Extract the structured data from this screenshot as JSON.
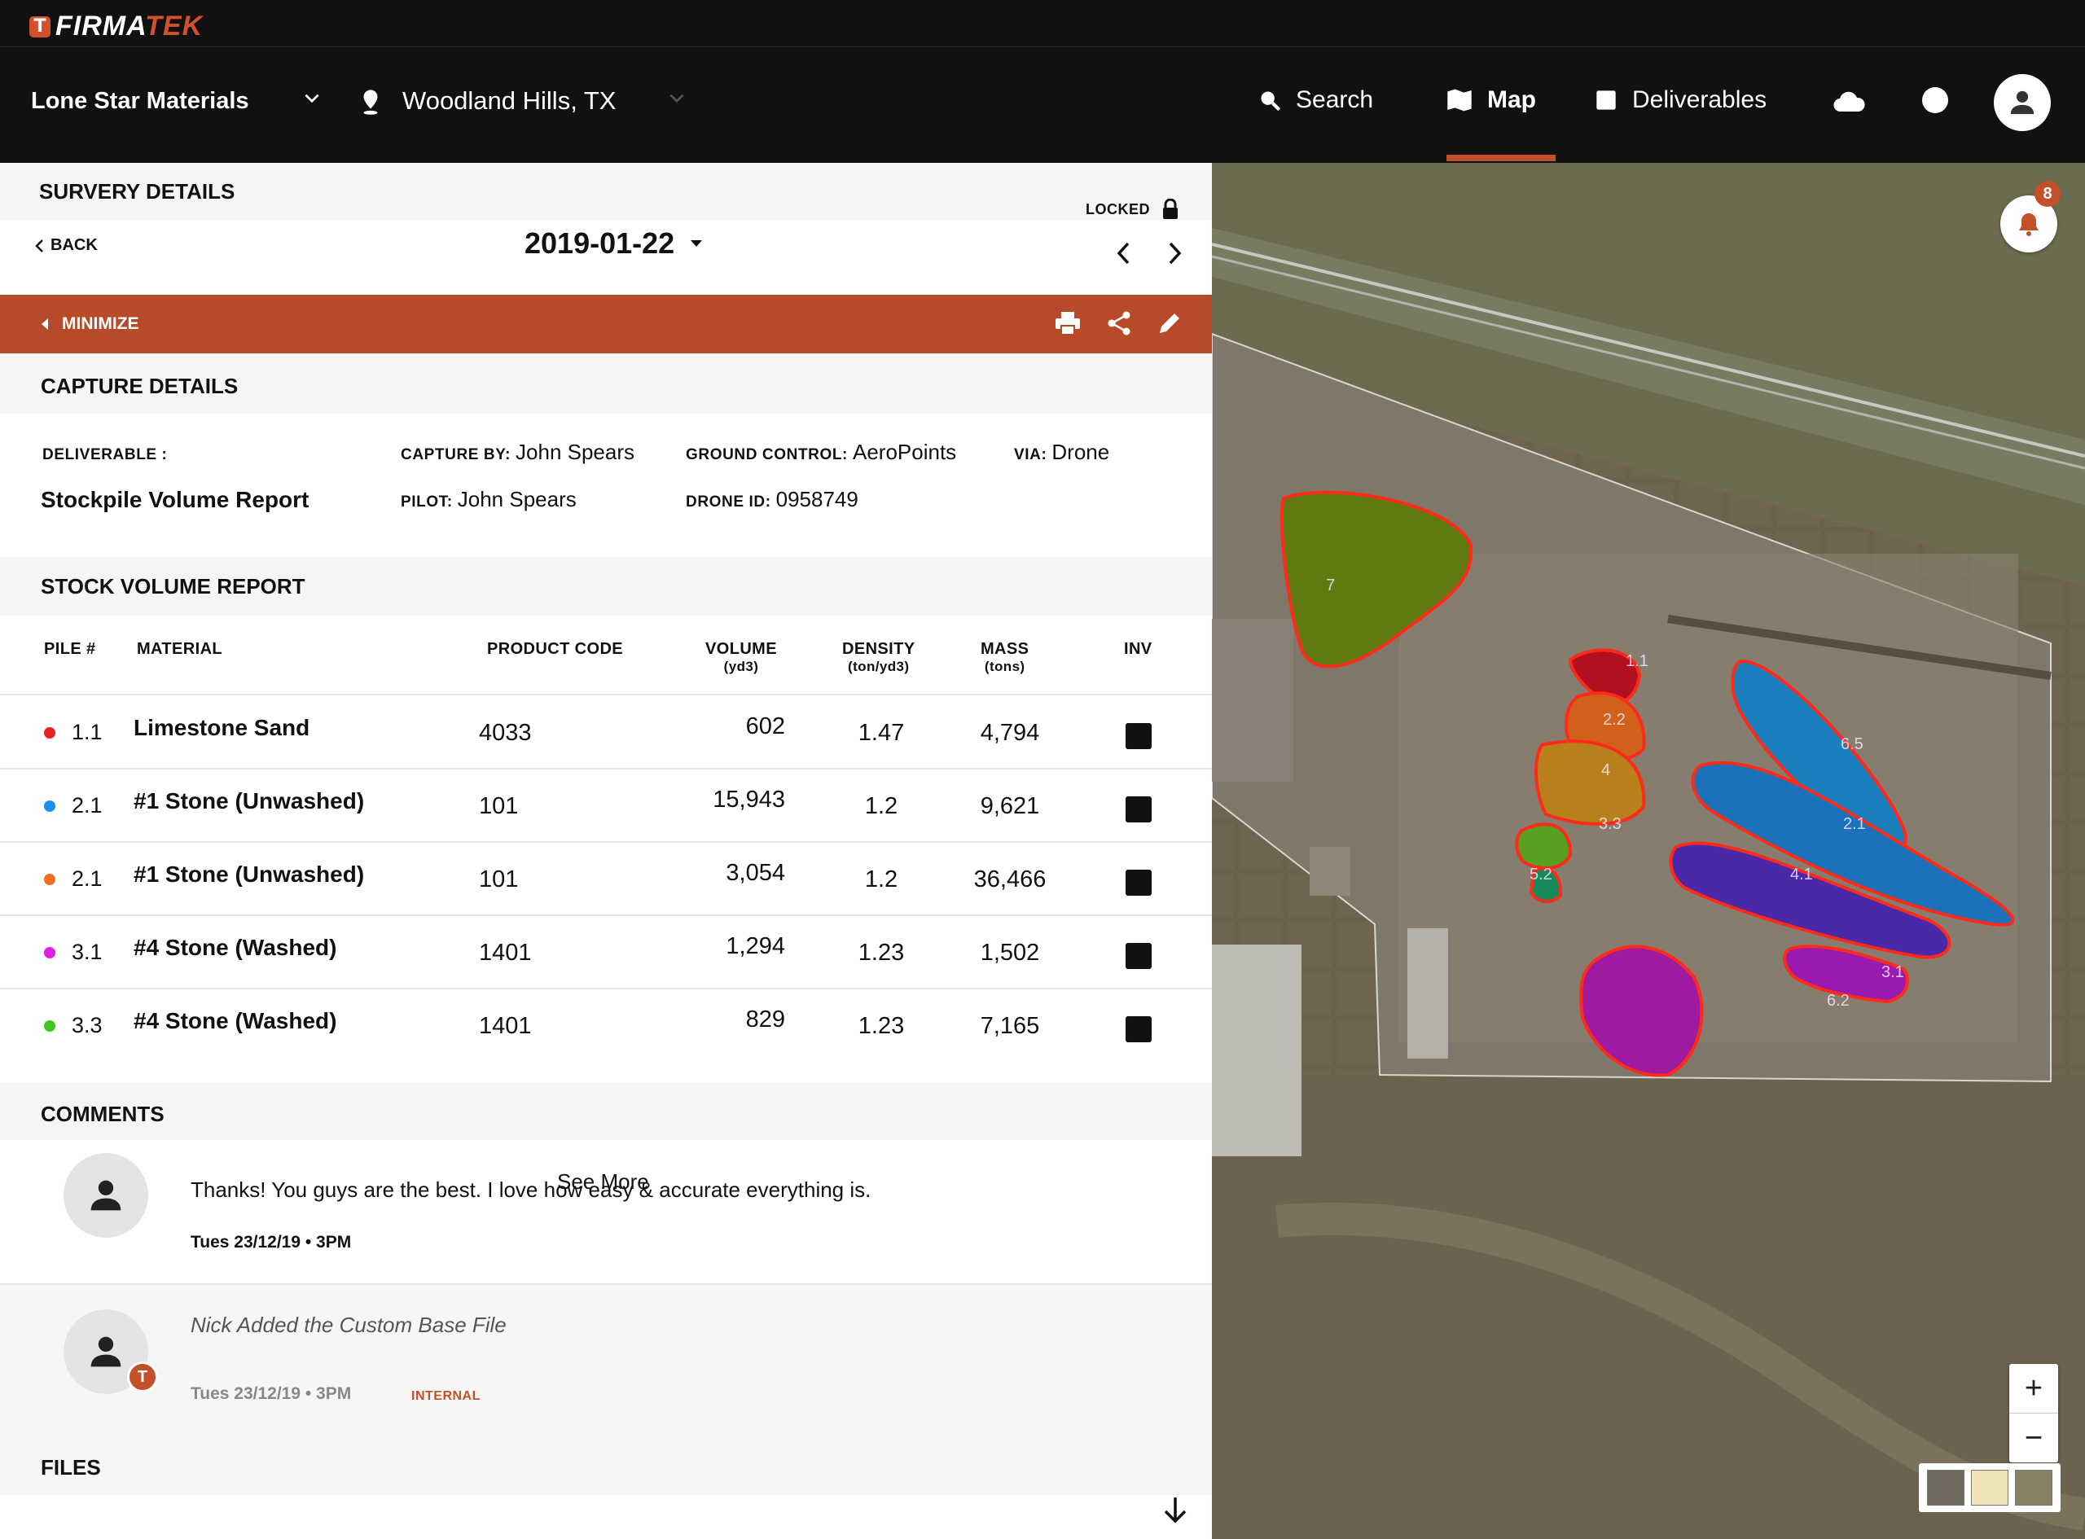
{
  "brand": {
    "mark": "T",
    "name_a": "FIRMA",
    "name_b": "TEK"
  },
  "nav": {
    "company": "Lone Star Materials",
    "location": "Woodland Hills, TX",
    "search": "Search",
    "map": "Map",
    "deliverables": "Deliverables"
  },
  "survey": {
    "title": "SURVERY DETAILS",
    "locked": "LOCKED",
    "back": "BACK",
    "date": "2019-01-22",
    "minimize": "MINIMIZE"
  },
  "capture": {
    "title": "CAPTURE DETAILS",
    "deliverable_label": "DELIVERABLE :",
    "deliverable_value": "Stockpile Volume Report",
    "capture_by_label": "CAPTURE BY:",
    "capture_by_value": "John Spears",
    "pilot_label": "PILOT:",
    "pilot_value": "John Spears",
    "ground_control_label": "GROUND CONTROL:",
    "ground_control_value": "AeroPoints",
    "drone_id_label": "DRONE ID:",
    "drone_id_value": "0958749",
    "via_label": "VIA:",
    "via_value": "Drone"
  },
  "stock": {
    "title": "STOCK VOLUME REPORT",
    "headers": {
      "pile": "PILE #",
      "material": "MATERIAL",
      "code": "PRODUCT CODE",
      "volume": "VOLUME",
      "volume_unit": "(yd3)",
      "density": "DENSITY",
      "density_unit": "(ton/yd3)",
      "mass": "MASS",
      "mass_unit": "(tons)",
      "inv": "INV"
    },
    "rows": [
      {
        "color": "#e8231f",
        "pile": "1.1",
        "material": "Limestone Sand",
        "code": "4033",
        "volume": "602",
        "density": "1.47",
        "mass": "4,794"
      },
      {
        "color": "#1e8fe6",
        "pile": "2.1",
        "material": "#1 Stone (Unwashed)",
        "code": "101",
        "volume": "15,943",
        "density": "1.2",
        "mass": "9,621"
      },
      {
        "color": "#f07020",
        "pile": "2.1",
        "material": "#1 Stone (Unwashed)",
        "code": "101",
        "volume": "3,054",
        "density": "1.2",
        "mass": "36,466"
      },
      {
        "color": "#e21ee0",
        "pile": "3.1",
        "material": "#4 Stone (Washed)",
        "code": "1401",
        "volume": "1,294",
        "density": "1.23",
        "mass": "1,502"
      },
      {
        "color": "#3ec820",
        "pile": "3.3",
        "material": "#4 Stone (Washed)",
        "code": "1401",
        "volume": "829",
        "density": "1.23",
        "mass": "7,165"
      }
    ],
    "see_more": "See More"
  },
  "comments": {
    "title": "COMMENTS",
    "items": [
      {
        "text": "Thanks! You guys are the best. I love how easy & accurate everything is.",
        "time": "Tues 23/12/19 • 3PM"
      },
      {
        "text": "Nick Added the Custom Base File",
        "time": "Tues 23/12/19 • 3PM",
        "tag": "INTERNAL",
        "badge": "T"
      }
    ]
  },
  "files": {
    "title": "FILES"
  },
  "map": {
    "notifications": "8",
    "zoom_in": "+",
    "zoom_out": "−",
    "pile_labels": [
      "7",
      "1.1",
      "2.2",
      "4",
      "3.3",
      "5.2",
      "6.5",
      "2.1",
      "4.1",
      "6.2",
      "3.1"
    ]
  }
}
